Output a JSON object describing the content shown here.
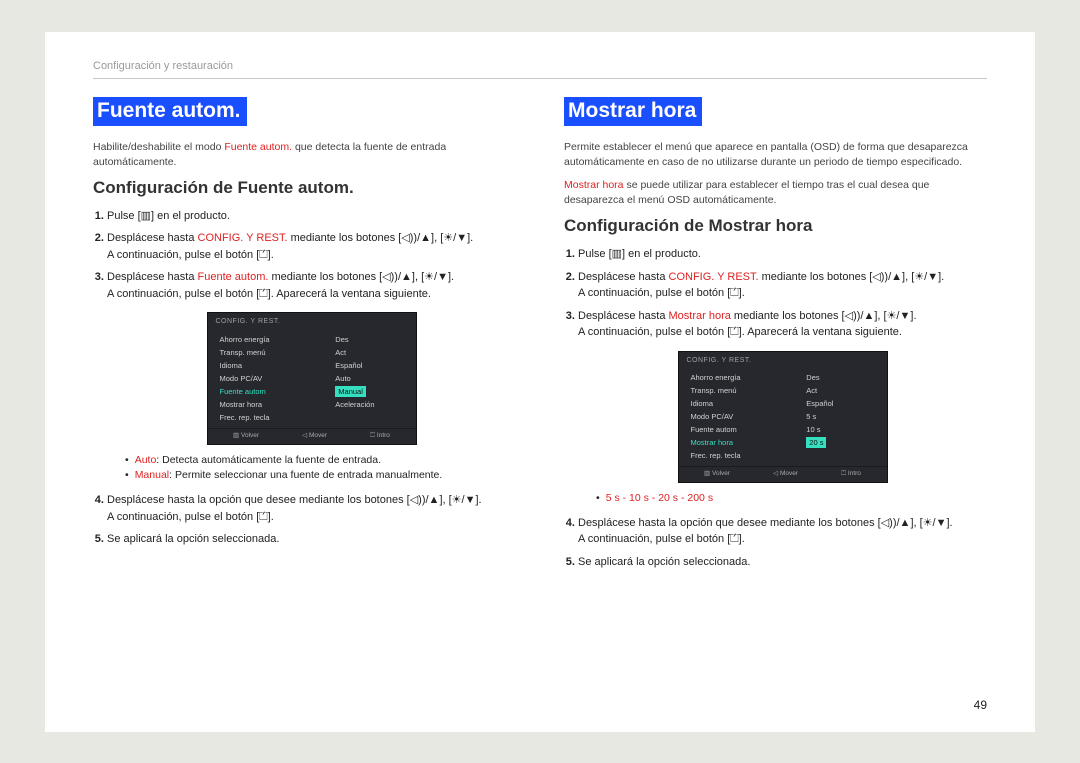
{
  "header": "Configuración y restauración",
  "page_number": "49",
  "icons": {
    "menu": "[▥]",
    "vol_up": "[◁))/▲]",
    "bri_down": "[☀/▼]",
    "enter": "[⏍]"
  },
  "left": {
    "title": "Fuente autom.",
    "desc_pre": "Habilite/deshabilite el modo ",
    "desc_red1": "Fuente autom.",
    "desc_post": " que detecta la fuente de entrada automáticamente.",
    "subhead": "Configuración de Fuente autom.",
    "step1_pre": "Pulse ",
    "step1_post": " en el producto.",
    "step2_pre": "Desplácese hasta ",
    "step2_red": "CONFIG. Y REST.",
    "step2_mid": " mediante los botones ",
    "step2_comma": ", ",
    "step2_end": ".",
    "step2_line2_pre": "A continuación, pulse el botón ",
    "step2_line2_end": ".",
    "step3_pre": "Desplácese hasta ",
    "step3_red": "Fuente autom.",
    "step3_mid": " mediante los botones ",
    "step3_line2_pre": "A continuación, pulse el botón ",
    "step3_line2_end": ". Aparecerá la ventana siguiente.",
    "bullet1_red": "Auto",
    "bullet1_rest": ": Detecta automáticamente la fuente de entrada.",
    "bullet2_red": "Manual",
    "bullet2_rest": ": Permite seleccionar una fuente de entrada manualmente.",
    "step4_pre": "Desplácese hasta la opción que desee mediante los botones ",
    "step4_comma": ", ",
    "step4_end": ".",
    "step4_line2_pre": "A continuación, pulse el botón ",
    "step4_line2_end": ".",
    "step5": "Se aplicará la opción seleccionada.",
    "osd": {
      "title": "CONFIG. Y REST.",
      "menu": [
        "Ahorro energía",
        "Transp. menú",
        "Idioma",
        "Modo PC/AV",
        "Fuente autom",
        "Mostrar hora",
        "Frec. rep. tecla"
      ],
      "highlight_index": 4,
      "vals": [
        "Des",
        "Act",
        "Español",
        "",
        "Auto",
        "Manual",
        "Aceleración"
      ],
      "val_sel_index": 5,
      "foot": [
        "▥ Volver",
        "◁ Mover",
        "⏍ Intro"
      ]
    }
  },
  "right": {
    "title": "Mostrar hora",
    "desc1": "Permite establecer el menú que aparece en pantalla (OSD) de forma que desaparezca automáticamente en caso de no utilizarse durante un periodo de tiempo especificado.",
    "desc2_red": "Mostrar hora",
    "desc2_rest": " se puede utilizar para establecer el tiempo tras el cual desea que desaparezca el menú OSD automáticamente.",
    "subhead": "Configuración de Mostrar hora",
    "step1_pre": "Pulse ",
    "step1_post": " en el producto.",
    "step2_pre": "Desplácese hasta ",
    "step2_red": "CONFIG. Y REST.",
    "step2_mid": " mediante los botones ",
    "step2_comma": ", ",
    "step2_end": ".",
    "step2_line2_pre": "A continuación, pulse el botón ",
    "step2_line2_end": ".",
    "step3_pre": "Desplácese hasta ",
    "step3_red": "Mostrar hora",
    "step3_mid": " mediante los botones ",
    "step3_line2_pre": "A continuación, pulse el botón ",
    "step3_line2_end": ". Aparecerá la ventana siguiente.",
    "options_line": "5 s - 10 s - 20 s - 200 s",
    "step4_pre": "Desplácese hasta la opción que desee mediante los botones ",
    "step4_comma": ", ",
    "step4_end": ".",
    "step4_line2_pre": "A continuación, pulse el botón ",
    "step4_line2_end": ".",
    "step5": "Se aplicará la opción seleccionada.",
    "osd": {
      "title": "CONFIG. Y REST.",
      "menu": [
        "Ahorro energía",
        "Transp. menú",
        "Idioma",
        "Modo PC/AV",
        "Fuente autom",
        "Mostrar hora",
        "Frec. rep. tecla"
      ],
      "highlight_index": 5,
      "vals": [
        "Des",
        "Act",
        "Español",
        "",
        "5 s",
        "10 s",
        "20 s"
      ],
      "val_sel_index": 6,
      "foot": [
        "▥ Volver",
        "◁ Mover",
        "⏍ Intro"
      ]
    }
  }
}
